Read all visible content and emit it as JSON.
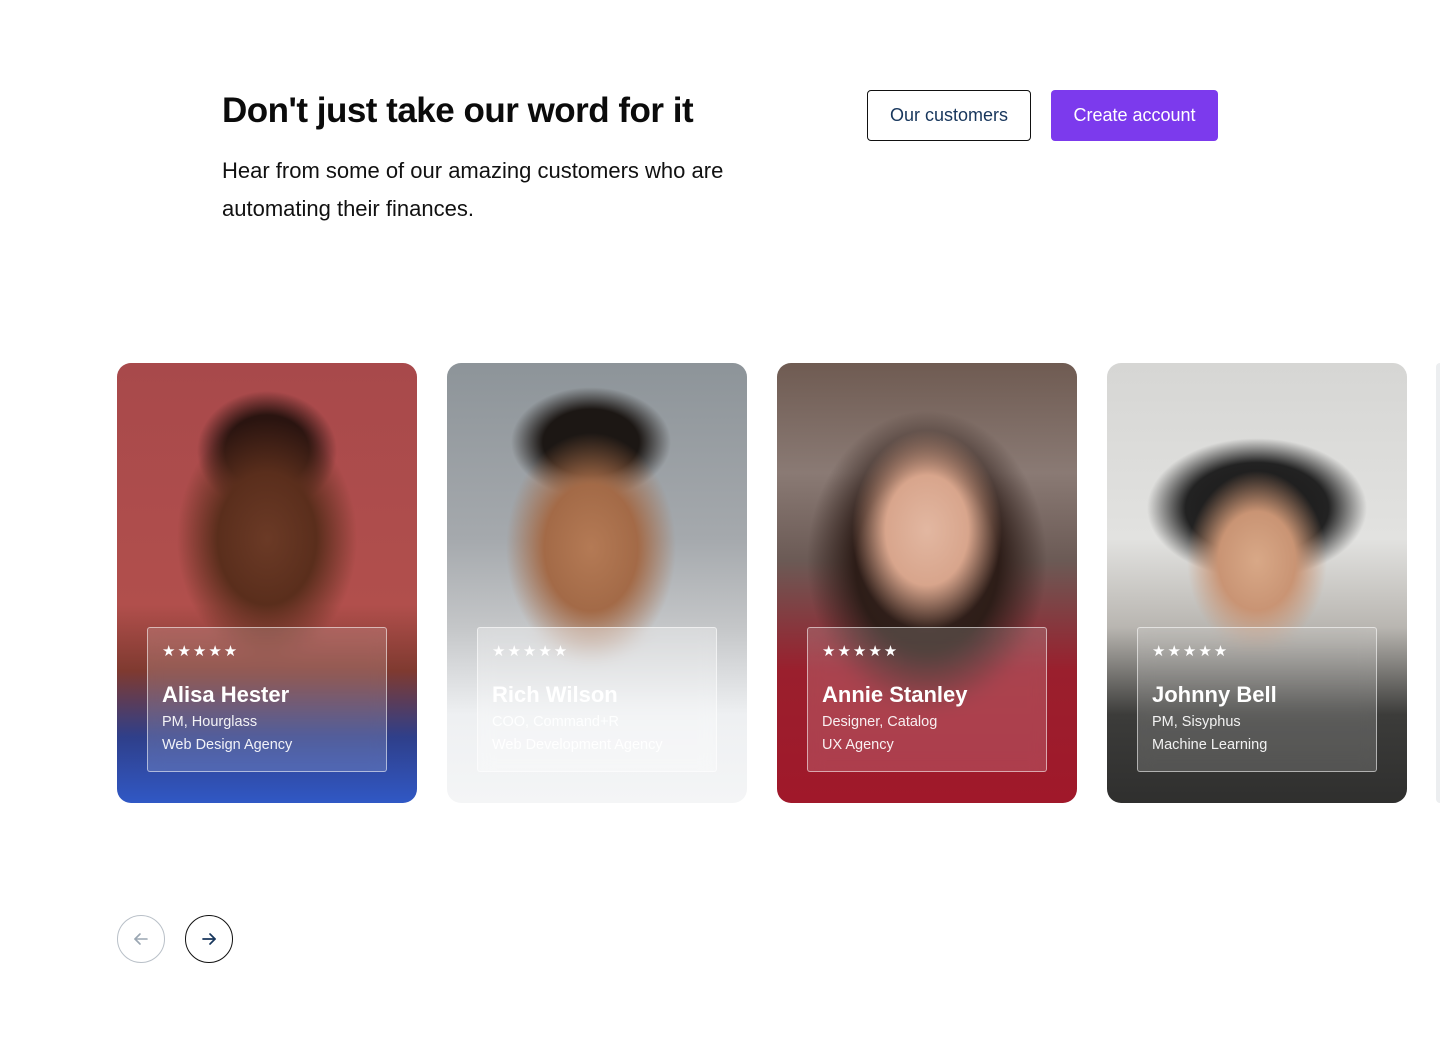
{
  "header": {
    "title": "Don't just take our word for it",
    "subtitle": "Hear from some of our amazing customers who are automating their finances."
  },
  "actions": {
    "customers_label": "Our customers",
    "create_label": "Create account",
    "primary_color": "#7c3aed"
  },
  "testimonials": [
    {
      "rating": "★★★★★",
      "name": "Alisa Hester",
      "role": "PM, Hourglass",
      "company": "Web Design Agency"
    },
    {
      "rating": "★★★★★",
      "name": "Rich Wilson",
      "role": "COO, Command+R",
      "company": "Web Development Agency"
    },
    {
      "rating": "★★★★★",
      "name": "Annie Stanley",
      "role": "Designer, Catalog",
      "company": "UX Agency"
    },
    {
      "rating": "★★★★★",
      "name": "Johnny Bell",
      "role": "PM, Sisyphus",
      "company": "Machine Learning"
    }
  ],
  "carousel": {
    "prev_icon": "arrow-left-icon",
    "next_icon": "arrow-right-icon"
  }
}
